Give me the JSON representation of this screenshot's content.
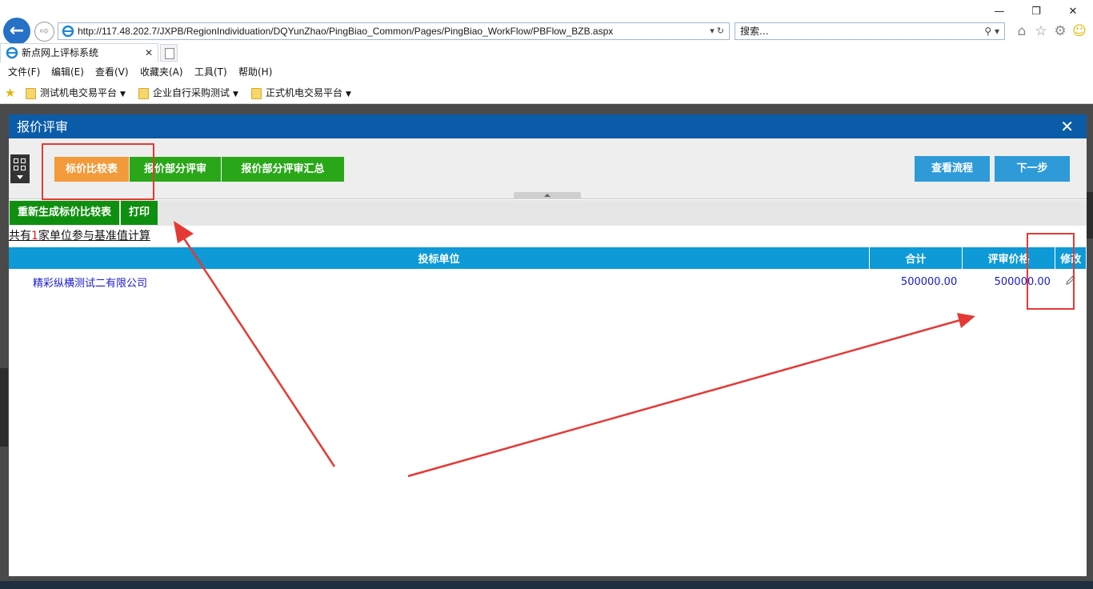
{
  "browser": {
    "url": "http://117.48.202.7/JXPB/RegionIndividuation/DQYunZhao/PingBiao_Common/Pages/PingBiao_WorkFlow/PBFlow_BZB.aspx",
    "search_placeholder": "搜索...",
    "tab_title": "新点网上评标系统",
    "menu": [
      "文件(F)",
      "编辑(E)",
      "查看(V)",
      "收藏夹(A)",
      "工具(T)",
      "帮助(H)"
    ],
    "favorites": [
      "测试机电交易平台",
      "企业自行采购测试",
      "正式机电交易平台"
    ]
  },
  "dialog": {
    "title": "报价评审",
    "tabs": [
      "标价比较表",
      "报价部分评审",
      "报价部分评审汇总"
    ],
    "right_buttons": [
      "查看流程",
      "下一步"
    ],
    "actions": [
      "重新生成标价比较表",
      "打印"
    ],
    "summary": {
      "prefix": "共有",
      "count": "1",
      "suffix": "家单位参与基准值计算"
    },
    "table": {
      "columns": [
        "投标单位",
        "合计",
        "评审价格",
        "修改"
      ],
      "rows": [
        {
          "bidder": "精彩纵横测试二有限公司",
          "total": "500000.00",
          "review_price": "500000.00"
        }
      ]
    }
  },
  "colors": {
    "title_bar": "#0b5ca8",
    "tab_active": "#f39a3b",
    "tab_inactive": "#2aa719",
    "button_blue": "#2e9ad8",
    "action_green": "#0f8f10",
    "table_header": "#0d9ad6",
    "annotation": "#e53935"
  }
}
